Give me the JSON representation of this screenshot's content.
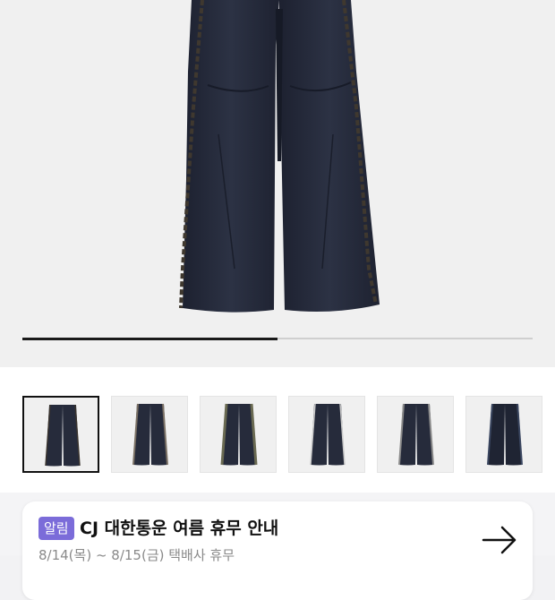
{
  "gallery": {
    "image_count": 6,
    "selected_index": 0,
    "progress_fraction": 0.5,
    "thumbnails": [
      {
        "label": "thumbnail-1",
        "trim_color": "#3a342e"
      },
      {
        "label": "thumbnail-2",
        "trim_color": "#7a7064"
      },
      {
        "label": "thumbnail-3",
        "trim_color": "#6a6a52"
      },
      {
        "label": "thumbnail-4",
        "trim_color": "#c8c8c8"
      },
      {
        "label": "thumbnail-5",
        "trim_color": "#8a8a8a"
      },
      {
        "label": "thumbnail-6",
        "trim_color": "#3a4660"
      }
    ]
  },
  "notice": {
    "badge": "알림",
    "title": "CJ 대한통운 여름 휴무 안내",
    "subtitle": "8/14(목) ~ 8/15(금) 택배사 휴무",
    "arrow_icon": "arrow-right-icon"
  },
  "colors": {
    "badge_bg": "#7b6cd9",
    "pants": "#262b3b"
  }
}
